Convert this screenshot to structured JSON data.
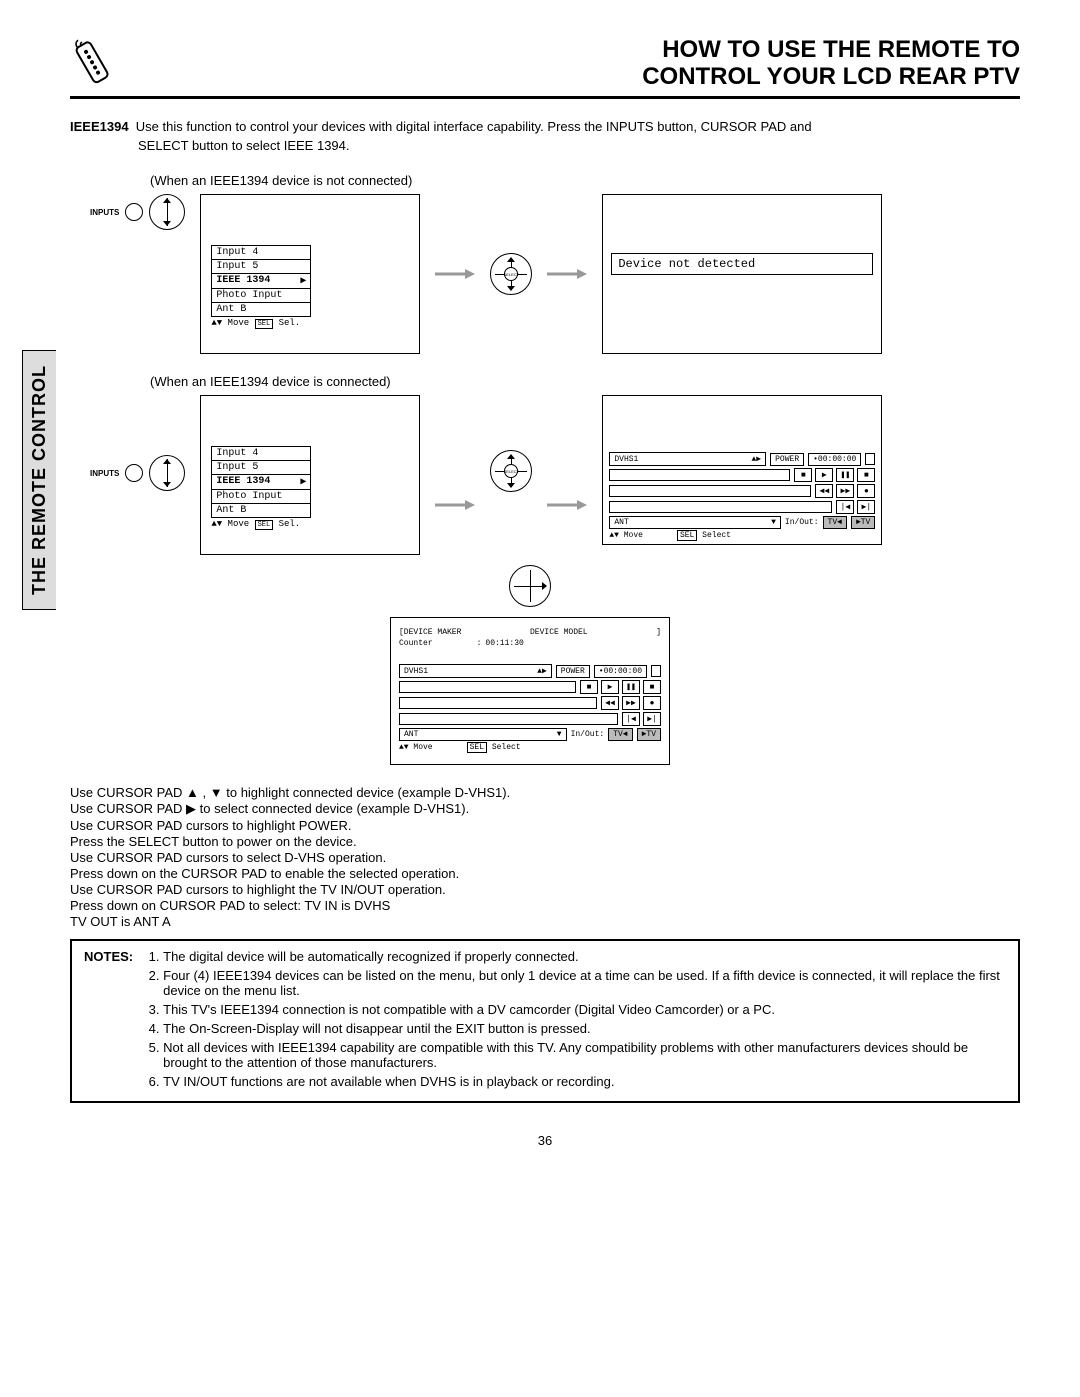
{
  "header": {
    "title_line1": "HOW TO USE THE REMOTE TO",
    "title_line2": "CONTROL YOUR LCD REAR PTV"
  },
  "sidebar_tab": "THE REMOTE CONTROL",
  "intro": {
    "label": "IEEE1394",
    "text1": "Use this function to control your devices with digital interface capability.  Press the INPUTS button, CURSOR PAD and",
    "text2": "SELECT button to select IEEE 1394."
  },
  "captions": {
    "not_connected": "(When an IEEE1394 device is not connected)",
    "connected": "(When an IEEE1394 device is connected)"
  },
  "remote": {
    "inputs_label": "INPUTS",
    "select_label": "SELECT"
  },
  "osd_menu": {
    "items": [
      "Input 4",
      "Input 5",
      "IEEE 1394",
      "Photo Input",
      "Ant B"
    ],
    "arrow": "▶",
    "footer_move": "Move",
    "footer_sel": "Sel.",
    "footer_sel_key": "SEL"
  },
  "not_detected_msg": "Device not detected",
  "control_panel": {
    "device_row": "DVHS1",
    "power": "POWER",
    "counter": "•00:00:00",
    "ant": "ANT",
    "inout": "In/Out:",
    "tv_in": "TV◄",
    "tv_out": "►TV",
    "move": "Move",
    "select": "Select",
    "sel_key": "SEL",
    "icons": [
      "■",
      "▶",
      "❚❚",
      "■",
      "◀◀",
      "▶▶",
      "●",
      "|◀",
      "▶|"
    ]
  },
  "detail_panel": {
    "header1_left": "[DEVICE MAKER",
    "header1_right": "DEVICE MODEL",
    "header1_close": "]",
    "counter_label": "Counter",
    "counter_colon": ":",
    "counter_val": "00:11:30"
  },
  "instructions": [
    "Use CURSOR PAD ▲ , ▼ to highlight connected device (example D-VHS1).",
    "Use CURSOR PAD  ▶  to select connected device (example D-VHS1).",
    "Use CURSOR PAD cursors to highlight POWER.",
    "Press the SELECT button to power on the device.",
    "Use CURSOR PAD cursors to select D-VHS operation.",
    "Press down on the CURSOR PAD to enable the selected operation.",
    "Use CURSOR PAD cursors to highlight the TV IN/OUT operation.",
    "Press down on CURSOR PAD to select: TV IN is DVHS"
  ],
  "instructions_last_indent": "TV OUT is ANT A",
  "notes": {
    "label": "NOTES:",
    "items": [
      "The digital device will be automatically recognized if properly connected.",
      "Four (4) IEEE1394 devices can be listed on the menu, but only 1 device at a time can be used.  If a fifth device is connected, it will replace the first device on the menu list.",
      "This TV's IEEE1394 connection is not compatible with a DV camcorder (Digital Video Camcorder) or a PC.",
      "The On-Screen-Display will not disappear until the EXIT button is pressed.",
      "Not all devices with IEEE1394 capability are compatible with this TV.  Any compatibility problems with other manufacturers devices should be brought to the attention of those manufacturers.",
      "TV IN/OUT functions are not available when DVHS is in playback or recording."
    ]
  },
  "page_number": "36"
}
